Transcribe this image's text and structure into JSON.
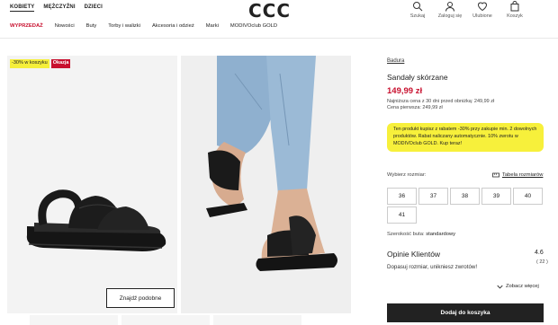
{
  "header": {
    "logo": "CCC",
    "top_nav": [
      "KOBIETY",
      "MĘŻCZYŹNI",
      "DZIECI"
    ],
    "icons": [
      {
        "label": "Szukaj",
        "icon": "search-icon"
      },
      {
        "label": "Zaloguj się",
        "icon": "user-icon"
      },
      {
        "label": "Ulubione",
        "icon": "heart-icon"
      },
      {
        "label": "Koszyk",
        "icon": "bag-icon"
      }
    ],
    "categories": [
      "WYPRZEDAŻ",
      "Nowości",
      "Buty",
      "Torby i walizki",
      "Akcesoria i odzież",
      "Marki",
      "MODIVOclub GOLD"
    ]
  },
  "gallery": {
    "badge_discount": "-30% w koszyku",
    "badge_deal": "Okazja",
    "similar_button": "Znajdź podobne"
  },
  "product": {
    "brand": "Badura",
    "name": "Sandały skórzane",
    "price": "149,99 zł",
    "lowest_price": "Najniższa cena z 30 dni przed obniżką: 249,99 zł",
    "first_price": "Cena pierwsza: 249,99 zł",
    "promo": "Ten produkt kupisz z rabatem -30% przy zakupie min. 2 dowolnych produktów. Rabat naliczany automatycznie. 10% zwrotu w MODIVOclub GOLD. Kup teraz!",
    "size_label": "Wybierz rozmiar:",
    "size_table": "Tabela rozmiarów",
    "sizes": [
      "36",
      "37",
      "38",
      "39",
      "40",
      "41"
    ],
    "width_label": "Szerokość buta:",
    "width_value": "standardowy",
    "reviews_title": "Opinie Klientów",
    "rating": "4.6",
    "rating_count": "( 22 )",
    "reviews_sub": "Dopasuj rozmiar, unikniesz zwrotów!",
    "show_more": "Zobacz więcej",
    "cart_button": "Dodaj do koszyka"
  },
  "colors": {
    "accent": "#c8102e",
    "promo_bg": "#f7f03b",
    "button_bg": "#222222"
  }
}
